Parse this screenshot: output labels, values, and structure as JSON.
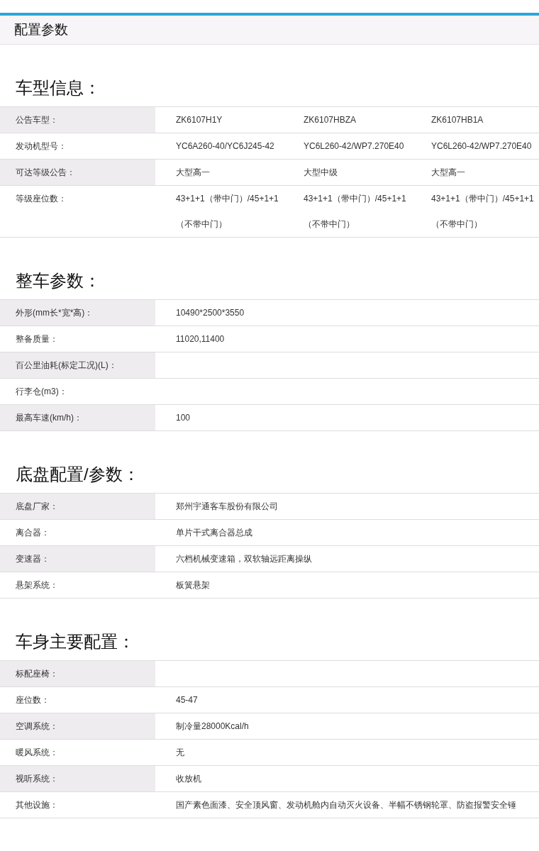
{
  "header": {
    "title": "配置参数"
  },
  "sections": [
    {
      "title": "车型信息：",
      "rows": [
        {
          "label": "公告车型：",
          "values": [
            "ZK6107H1Y",
            "ZK6107HBZA",
            "ZK6107HB1A"
          ]
        },
        {
          "label": "发动机型号：",
          "values": [
            "YC6A260-40/YC6J245-42",
            "YC6L260-42/WP7.270E40",
            "YC6L260-42/WP7.270E40"
          ]
        },
        {
          "label": "可达等级公告：",
          "values": [
            "大型高一",
            "大型中级",
            "大型高一"
          ]
        },
        {
          "label": "等级座位数：",
          "values": [
            "43+1+1（带中门）/45+1+1（不带中门）",
            "43+1+1（带中门）/45+1+1（不带中门）",
            "43+1+1（带中门）/45+1+1（不带中门）"
          ]
        }
      ]
    },
    {
      "title": "整车参数：",
      "rows": [
        {
          "label": "外形(mm长*宽*高)：",
          "values": [
            "10490*2500*3550"
          ]
        },
        {
          "label": "整备质量：",
          "values": [
            "11020,11400"
          ]
        },
        {
          "label": "百公里油耗(标定工况)(L)：",
          "values": []
        },
        {
          "label": "行李仓(m3)：",
          "values": []
        },
        {
          "label": "最高车速(km/h)：",
          "values": [
            "100"
          ]
        }
      ]
    },
    {
      "title": "底盘配置/参数：",
      "rows": [
        {
          "label": "底盘厂家：",
          "values": [
            "郑州宇通客车股份有限公司"
          ]
        },
        {
          "label": "离合器：",
          "values": [
            "单片干式离合器总成"
          ]
        },
        {
          "label": "变速器：",
          "values": [
            "六档机械变速箱，双软轴远距离操纵"
          ]
        },
        {
          "label": "悬架系统：",
          "values": [
            "板簧悬架"
          ]
        }
      ]
    },
    {
      "title": "车身主要配置：",
      "rows": [
        {
          "label": "标配座椅：",
          "values": []
        },
        {
          "label": "座位数：",
          "values": [
            "45-47"
          ]
        },
        {
          "label": "空调系统：",
          "values": [
            "制冷量28000Kcal/h"
          ]
        },
        {
          "label": "暖风系统：",
          "values": [
            "无"
          ]
        },
        {
          "label": "视听系统：",
          "values": [
            "收放机"
          ]
        },
        {
          "label": "其他设施：",
          "values": [
            "国产素色面漆、安全顶风窗、发动机舱内自动灭火设备、半幅不锈钢轮罩、防盗报警安全锤"
          ]
        }
      ]
    }
  ]
}
